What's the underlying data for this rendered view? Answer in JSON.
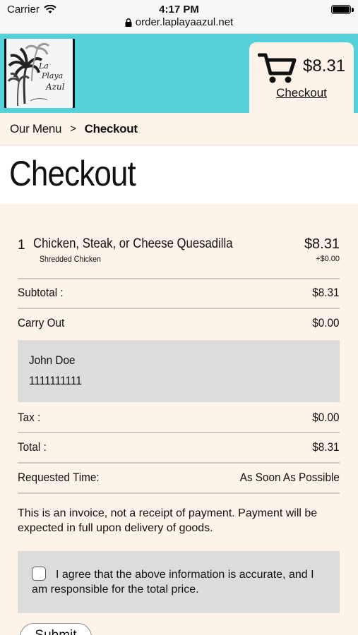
{
  "status_bar": {
    "carrier": "Carrier",
    "time": "4:17 PM"
  },
  "browser": {
    "url": "order.laplayaazul.net"
  },
  "header": {
    "logo_alt": "La Playa Azul",
    "cart_total": "$8.31",
    "checkout_link": "Checkout"
  },
  "breadcrumb": {
    "menu": "Our Menu",
    "separator": ">",
    "current": "Checkout"
  },
  "page_title": "Checkout",
  "order": {
    "items": [
      {
        "qty": "1",
        "name": "Chicken, Steak, or Cheese Quesadilla",
        "modifier": "Shredded Chicken",
        "price": "$8.31",
        "modifier_price": "+$0.00"
      }
    ],
    "subtotal_label": "Subtotal :",
    "subtotal": "$8.31",
    "order_type_label": "Carry Out",
    "order_type_value": "$0.00",
    "contact": {
      "name": "John Doe",
      "phone": "1111111111"
    },
    "tax_label": "Tax :",
    "tax": "$0.00",
    "total_label": "Total :",
    "total": "$8.31",
    "requested_time_label": "Requested Time:",
    "requested_time": "As Soon As Possible"
  },
  "notice": "This is an invoice, not a receipt of payment. Payment will be expected in full upon delivery of goods.",
  "agreement": {
    "label": "I agree that the above information is accurate, and I am responsible for the total price.",
    "checked": false
  },
  "submit_label": "Submit"
}
